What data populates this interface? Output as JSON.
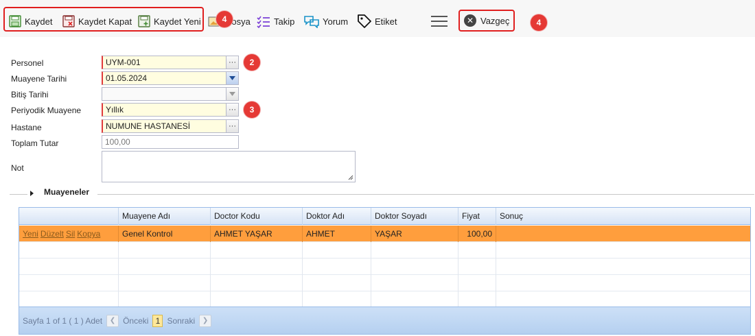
{
  "toolbar": {
    "kaydet": "Kaydet",
    "kaydet_kapat": "Kaydet Kapat",
    "kaydet_yeni": "Kaydet Yeni",
    "dosya": "Dosya",
    "takip": "Takip",
    "yorum": "Yorum",
    "etiket": "Etiket",
    "vazgec": "Vazgeç"
  },
  "badges": {
    "toolbar": "4",
    "vazgec": "4",
    "personel": "2",
    "periyodik": "3"
  },
  "form": {
    "personel_label": "Personel",
    "personel_value": "UYM-001",
    "muayene_tarihi_label": "Muayene Tarihi",
    "muayene_tarihi_value": "01.05.2024",
    "bitis_tarihi_label": "Bitiş Tarihi",
    "bitis_tarihi_value": "",
    "periyodik_label": "Periyodik Muayene",
    "periyodik_value": "Yıllık",
    "hastane_label": "Hastane",
    "hastane_value": "NUMUNE HASTANESİ",
    "toplam_label": "Toplam Tutar",
    "toplam_value": "100,00",
    "not_label": "Not",
    "not_value": "",
    "lookup_button": "···"
  },
  "section": {
    "title": "Muayeneler"
  },
  "grid": {
    "columns": [
      "",
      "Muayene Adı",
      "Doctor Kodu",
      "Doktor Adı",
      "Doktor Soyadı",
      "Fiyat",
      "Sonuç"
    ],
    "actions": [
      "Yeni",
      "Düzelt",
      "Sil",
      "Kopya"
    ],
    "rows": [
      {
        "muayene_adi": "Genel Kontrol",
        "doctor_kodu": "AHMET YAŞAR",
        "doktor_adi": "AHMET",
        "doktor_soyadi": "YAŞAR",
        "fiyat": "100,00",
        "sonuc": ""
      }
    ]
  },
  "pager": {
    "info": "Sayfa 1 of 1 ( 1 ) Adet",
    "prev": "Önceki",
    "page": "1",
    "next": "Sonraki"
  },
  "colors": {
    "highlight": "#e01e1e",
    "badge": "#e53935",
    "selected_row": "#ff9e3d",
    "required_bg": "#fffde0",
    "grid_header": "#d6e3f5"
  }
}
